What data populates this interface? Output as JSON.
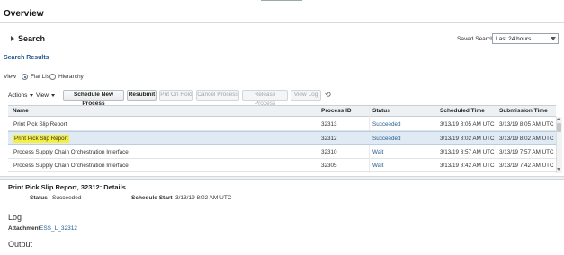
{
  "page": {
    "title": "Overview"
  },
  "search": {
    "label": "Search",
    "saved_search_label": "Saved Search",
    "saved_search_value": "Last 24 hours"
  },
  "results": {
    "title": "Search Results",
    "view_label": "View",
    "view_options": [
      "Flat List",
      "Hierarchy"
    ],
    "selected_view": "Flat List"
  },
  "toolbar": {
    "actions_label": "Actions",
    "view_label": "View",
    "schedule_new_process": "Schedule New Process",
    "resubmit": "Resubmit",
    "put_on_hold": "Put On Hold",
    "cancel_process": "Cancel Process",
    "release_process": "Release Process",
    "view_log": "View Log",
    "refresh_glyph": "⟲"
  },
  "table": {
    "columns": [
      "Name",
      "Process ID",
      "Status",
      "Scheduled Time",
      "Submission Time"
    ],
    "rows": [
      {
        "name": "Print Pick Slip Report",
        "process_id": "32313",
        "status": "Succeeded",
        "scheduled": "3/13/19 8:05 AM UTC",
        "submitted": "3/13/19 8:05 AM UTC"
      },
      {
        "name": "Print Pick Slip Report",
        "process_id": "32312",
        "status": "Succeeded",
        "scheduled": "3/13/19 8:02 AM UTC",
        "submitted": "3/13/19 8:02 AM UTC"
      },
      {
        "name": "Process Supply Chain Orchestration Interface",
        "process_id": "32310",
        "status": "Wait",
        "scheduled": "3/13/19 8:57 AM UTC",
        "submitted": "3/13/19 7:57 AM UTC"
      },
      {
        "name": "Process Supply Chain Orchestration Interface",
        "process_id": "32305",
        "status": "Wait",
        "scheduled": "3/13/19 8:42 AM UTC",
        "submitted": "3/13/19 7:42 AM UTC"
      }
    ],
    "selected_row_index": 1
  },
  "details": {
    "title": "Print Pick Slip Report, 32312: Details",
    "status_label": "Status",
    "status_value": "Succeeded",
    "schedule_start_label": "Schedule Start",
    "schedule_start_value": "3/13/19 8:02 AM UTC",
    "log_title": "Log",
    "attachment_label": "Attachment",
    "attachment_value": "ESS_L_32312",
    "output_title": "Output"
  },
  "colors": {
    "link": "#245a8c",
    "highlight": "#f5f040",
    "selected_row": "#dfeaf5"
  }
}
